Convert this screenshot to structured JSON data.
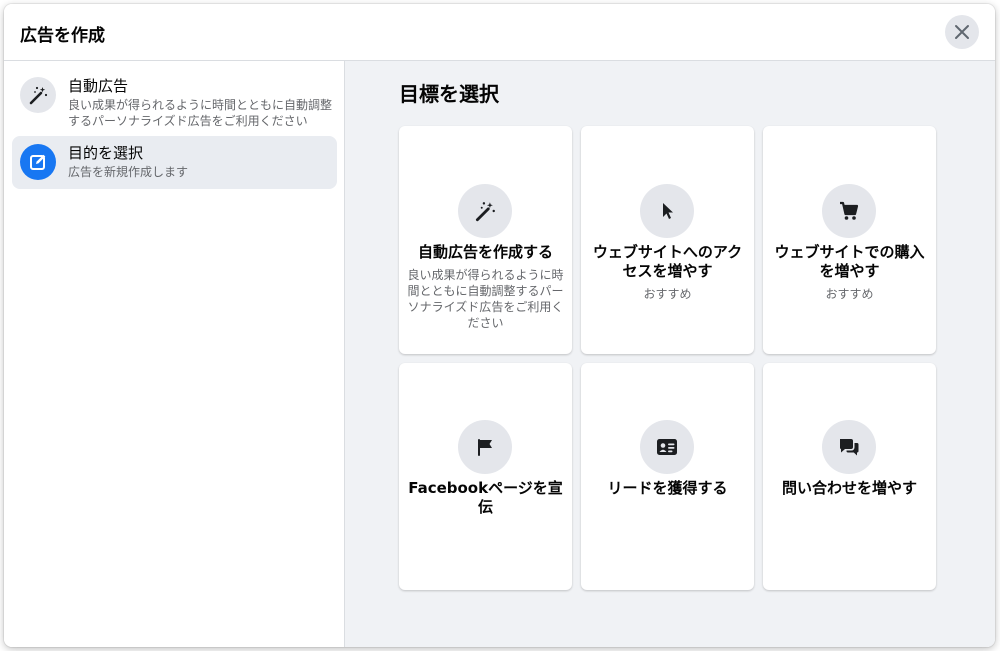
{
  "dialog": {
    "title": "広告を作成"
  },
  "sidebar": {
    "items": [
      {
        "title": "自動広告",
        "description": "良い成果が得られるように時間とともに自動調整するパーソナライズド広告をご利用ください",
        "icon": "magic-wand-icon"
      },
      {
        "title": "目的を選択",
        "description": "広告を新規作成します",
        "icon": "edit-icon"
      }
    ]
  },
  "main": {
    "title": "目標を選択",
    "cards": [
      {
        "title": "自動広告を作成する",
        "description": "良い成果が得られるように時間とともに自動調整するパーソナライズド広告をご利用ください",
        "icon": "magic-wand-icon"
      },
      {
        "title": "ウェブサイトへのアクセスを増やす",
        "description": "おすすめ",
        "icon": "cursor-icon"
      },
      {
        "title": "ウェブサイトでの購入を増やす",
        "description": "おすすめ",
        "icon": "cart-icon"
      },
      {
        "title": "Facebookページを宣伝",
        "description": "",
        "icon": "flag-icon"
      },
      {
        "title": "リードを獲得する",
        "description": "",
        "icon": "contact-card-icon"
      },
      {
        "title": "問い合わせを増やす",
        "description": "",
        "icon": "chat-bubbles-icon"
      }
    ]
  },
  "colors": {
    "accent": "#1877f2",
    "main_bg": "#f0f2f5",
    "active_item_bg": "#e9ecf1",
    "icon_circle_bg": "#e4e6eb",
    "secondary_text": "#65676b"
  }
}
